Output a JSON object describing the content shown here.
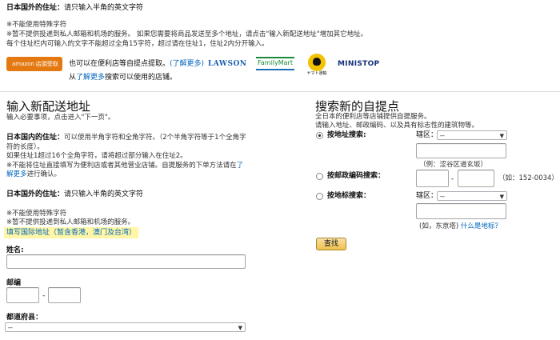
{
  "top": {
    "overseas_label": "日本国外的住址：",
    "overseas_text": "请只输入半角的英文字符",
    "note1": "※不能使用特殊字符",
    "note2": "※暂不提供投递到私人邮箱和机场的服务。 如果您需要将商品发送至多个地址，请点击\"输入新配送地址\"增加其它地址。",
    "note3": "每个住址栏内可输入的文字不能超过全角15字符，超过请在住址1，住址2内分开输入。",
    "amazon_logo": "amazon",
    "amazon_logo_sub": "店頭受取",
    "pickup_text": "也可以在便利店等自提点提取。",
    "pickup_link": "(了解更多)",
    "logo_lawson": "LAWSON",
    "logo_familymart": "FamilyMart",
    "logo_yamato": "ヤマト運輸",
    "logo_ministop": "MINISTOP",
    "search_prefix": "从",
    "search_link": "了解更多",
    "search_suffix": "搜索可以使用的店铺。"
  },
  "left": {
    "heading": "输入新配送地址",
    "subheading": "输入必要事项，点击进入\"下一页\"。",
    "domestic_label": "日本国内的住址：",
    "domestic_text": "可以使用半角字符和全角字符。（2个半角字符等于1个全角字符的长度）。",
    "domestic_note": "如果住址1超过16个全角字符，请将超过部分输入在住址2。",
    "no_store_text": "※不能将住址直接填写为便利店或者其他营业店铺。自提服务的下单方法请在",
    "no_store_link": "了解更多",
    "no_store_suffix": "进行确认。",
    "overseas_label": "日本国外的住址：",
    "overseas_text": "请只输入半角的英文字符",
    "note1": "※不能使用特殊字符",
    "note2": "※暂不提供投递到私人邮箱和机场的服务。",
    "intl_link": "填写国际地址（暂含香港，澳门及台湾）",
    "name_label": "姓名:",
    "postal_label": "邮编",
    "postal_sep": "-",
    "prefecture_label": "都道府县：",
    "prefecture_value": "--"
  },
  "right": {
    "heading": "搜索新的自提点",
    "desc1": "全日本的便利店等店铺提供自提服务。",
    "desc2": "请输入地址、邮政编码、以及具有标志性的建筑物等。",
    "opt1_label": "按地址搜索:",
    "ward_label": "辖区：",
    "ward_value": "--",
    "opt1_example": "（例：涩谷区道玄坂）",
    "opt2_label": "按邮政编码搜索：",
    "postal_sep": "-",
    "opt2_example": "（如：152-0034）",
    "opt3_label": "按地标搜索：",
    "ward2_label": "辖区：",
    "ward2_value": "--",
    "opt3_example": "(如，东京塔)",
    "landmark_link": "什么是地标？",
    "search_button": "查找"
  },
  "colors": {
    "link": "#0066c0",
    "amazon_orange": "#e47911",
    "highlight": "#fff6a6",
    "button": "#f0c14b"
  }
}
